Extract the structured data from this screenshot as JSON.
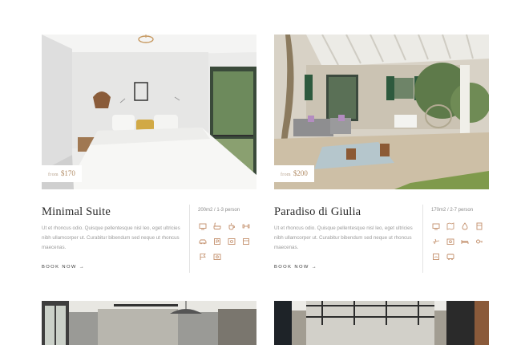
{
  "rooms": [
    {
      "title": "Minimal Suite",
      "price_prefix": "from",
      "price": "$170",
      "meta": "200m2 / 1-3 person",
      "description": "Ut et rhoncus odio. Quisque pellentesque nisl leo, eget ultricies nibh ullamcorper ut. Curabitur bibendum sed neque ut rhoncus maecenas.",
      "book_label": "BOOK NOW",
      "book_arrow": "→",
      "amenities": [
        "tv-icon",
        "bathtub-icon",
        "coffee-icon",
        "fitness-icon",
        "car-icon",
        "parking-icon",
        "phone-icon",
        "towel-icon",
        "flag-icon",
        "safe-icon"
      ]
    },
    {
      "title": "Paradiso di Giulia",
      "price_prefix": "from",
      "price": "$200",
      "meta": "170m2 / 2-7 person",
      "description": "Ut et rhoncus odio. Quisque pellentesque nisl leo, eget ultricies nibh ullamcorper ut. Curabitur bibendum sed neque ut rhoncus maecenas.",
      "book_label": "BOOK NOW",
      "book_arrow": "→",
      "amenities": [
        "tv-icon",
        "map-icon",
        "drop-icon",
        "fridge-icon",
        "plane-icon",
        "safe-icon",
        "bed-icon",
        "key-icon",
        "wifi-icon",
        "bus-icon"
      ]
    }
  ],
  "colors": {
    "accent": "#c28e6a",
    "title": "#2a2a2a",
    "body_text": "#9b9b9b"
  }
}
